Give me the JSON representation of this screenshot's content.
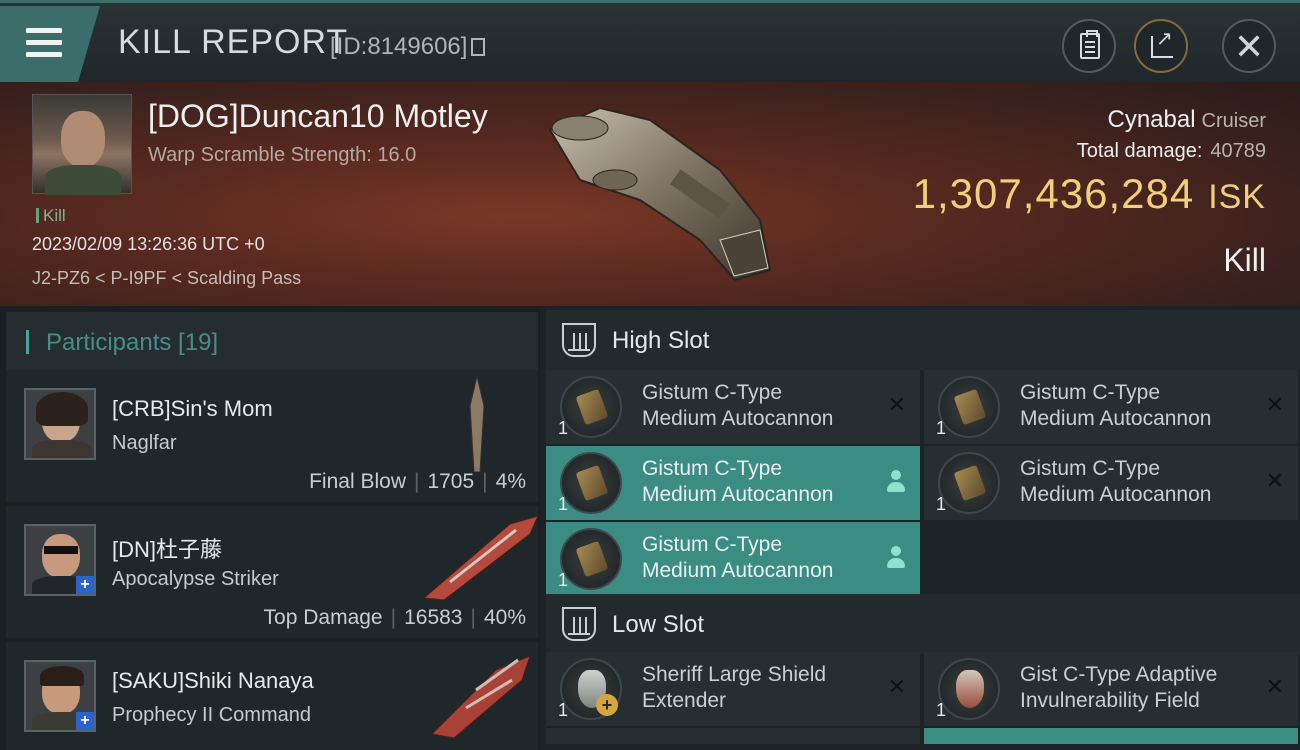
{
  "header": {
    "title": "KILL REPORT",
    "report_id": "[ID:8149606]"
  },
  "victim": {
    "name": "[DOG]Duncan10 Motley",
    "warp_scramble": "Warp Scramble Strength: 16.0",
    "kill_tag": "Kill",
    "timestamp": "2023/02/09 13:26:36 UTC +0",
    "location": "J2-PZ6 < P-I9PF < Scalding Pass",
    "ship_name": "Cynabal",
    "ship_class": "Cruiser",
    "total_damage_label": "Total damage:",
    "total_damage": "40789",
    "isk_value": "1,307,436,284",
    "isk_unit": "ISK",
    "result_label": "Kill"
  },
  "participants": {
    "header": "Participants [19]",
    "rows": [
      {
        "name": "[CRB]Sin's Mom",
        "ship": "Naglfar",
        "tag": "Final Blow",
        "damage": "1705",
        "percent": "4%"
      },
      {
        "name": "[DN]杜子藤",
        "ship": "Apocalypse Striker",
        "tag": "Top Damage",
        "damage": "16583",
        "percent": "40%"
      },
      {
        "name": "[SAKU]Shiki Nanaya",
        "ship": "Prophecy II Command",
        "tag": "",
        "damage": "",
        "percent": ""
      }
    ]
  },
  "fitting": {
    "high_slot_title": "High Slot",
    "low_slot_title": "Low Slot",
    "high_slot": [
      {
        "line1": "Gistum C-Type",
        "line2": "Medium Autocannon",
        "qty": "1",
        "state": "destroyed"
      },
      {
        "line1": "Gistum C-Type",
        "line2": "Medium Autocannon",
        "qty": "1",
        "state": "destroyed"
      },
      {
        "line1": "Gistum C-Type",
        "line2": "Medium Autocannon",
        "qty": "1",
        "state": "dropped"
      },
      {
        "line1": "Gistum C-Type",
        "line2": "Medium Autocannon",
        "qty": "1",
        "state": "destroyed"
      },
      {
        "line1": "Gistum C-Type",
        "line2": "Medium Autocannon",
        "qty": "1",
        "state": "dropped"
      }
    ],
    "low_slot": [
      {
        "line1": "Sheriff Large Shield",
        "line2": "Extender",
        "qty": "1",
        "state": "destroyed"
      },
      {
        "line1": "Gist C-Type Adaptive",
        "line2": "Invulnerability Field",
        "qty": "1",
        "state": "destroyed"
      }
    ]
  },
  "colors": {
    "accent": "#3b8c83",
    "isk": "#f2cf7a",
    "kill_tag": "#7fb58e"
  }
}
